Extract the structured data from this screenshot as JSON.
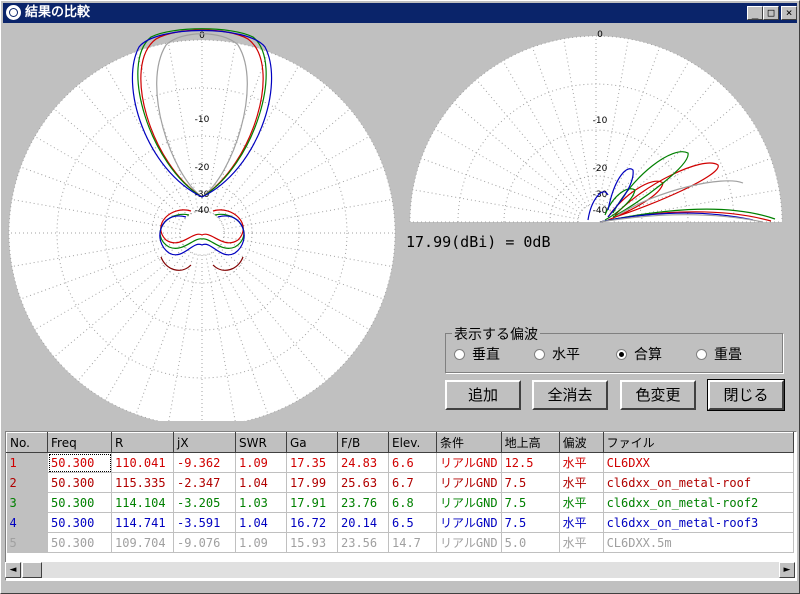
{
  "window": {
    "title": "結果の比較",
    "minimize": "_",
    "maximize": "□",
    "close": "×"
  },
  "reference": {
    "text": "17.99(dBi) = 0dB"
  },
  "polarization": {
    "legend": "表示する偏波",
    "options": [
      "垂直",
      "水平",
      "合算",
      "重畳"
    ],
    "selected": "合算"
  },
  "buttons": {
    "add": "追加",
    "clear_all": "全消去",
    "change_color": "色変更",
    "close": "閉じる"
  },
  "table": {
    "headers": [
      "No.",
      "Freq",
      "R",
      "jX",
      "SWR",
      "Ga",
      "F/B",
      "Elev.",
      "条件",
      "地上高",
      "偏波",
      "ファイル"
    ],
    "rows": [
      {
        "no": "1",
        "color": "#d00000",
        "cells": [
          "50.300",
          "110.041",
          "-9.362",
          "1.09",
          "17.35",
          "24.83",
          "6.6",
          "リアルGND",
          "12.5",
          "水平",
          "CL6DXX"
        ]
      },
      {
        "no": "2",
        "color": "#b00000",
        "cells": [
          "50.300",
          "115.335",
          "-2.347",
          "1.04",
          "17.99",
          "25.63",
          "6.7",
          "リアルGND",
          "7.5",
          "水平",
          "cl6dxx_on_metal-roof"
        ]
      },
      {
        "no": "3",
        "color": "#008000",
        "cells": [
          "50.300",
          "114.104",
          "-3.205",
          "1.03",
          "17.91",
          "23.76",
          "6.8",
          "リアルGND",
          "7.5",
          "水平",
          "cl6dxx_on_metal-roof2"
        ]
      },
      {
        "no": "4",
        "color": "#0000c0",
        "cells": [
          "50.300",
          "114.741",
          "-3.591",
          "1.04",
          "16.72",
          "20.14",
          "6.5",
          "リアルGND",
          "7.5",
          "水平",
          "cl6dxx_on_metal-roof3"
        ]
      },
      {
        "no": "5",
        "color": "#a0a0a0",
        "cells": [
          "50.300",
          "109.704",
          "-9.076",
          "1.09",
          "15.93",
          "23.56",
          "14.7",
          "リアルGND",
          "5.0",
          "水平",
          "CL6DXX.5m"
        ]
      }
    ]
  },
  "plots": {
    "azimuth": {
      "ring_labels": [
        "0",
        "-10",
        "-20",
        "-30",
        "-40"
      ]
    },
    "elevation": {
      "ring_labels": [
        "0",
        "-10",
        "-20",
        "-30",
        "-40"
      ]
    }
  },
  "scroll": {
    "left": "◄",
    "right": "►"
  }
}
